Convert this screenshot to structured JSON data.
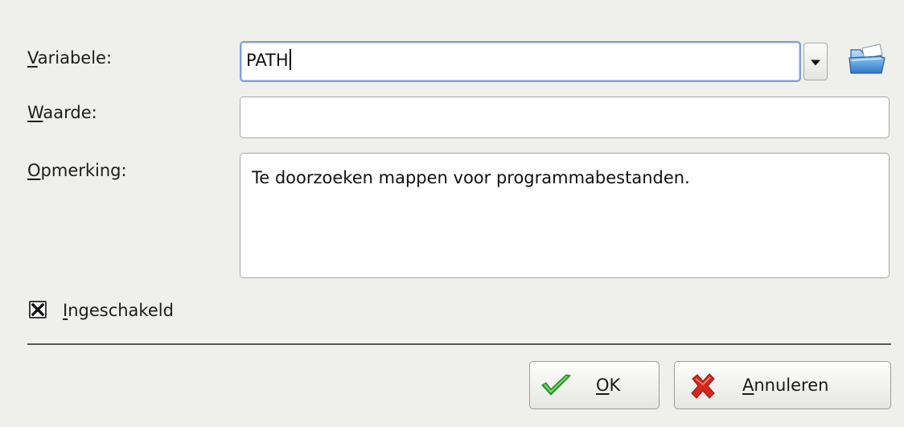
{
  "form": {
    "variable": {
      "label_mnemonic": "V",
      "label_rest": "ariabele:",
      "value": "PATH"
    },
    "value": {
      "label_mnemonic": "W",
      "label_rest": "aarde:",
      "value": ""
    },
    "comment": {
      "label_mnemonic": "O",
      "label_rest": "pmerking:",
      "value": "Te doorzoeken mappen voor programmabestanden."
    },
    "enabled": {
      "label_mnemonic": "I",
      "label_rest": "ngeschakeld",
      "checked": true
    }
  },
  "buttons": {
    "ok": {
      "label_mnemonic": "O",
      "label_rest": "K",
      "icon": "checkmark-icon"
    },
    "cancel": {
      "label_mnemonic": "A",
      "label_rest": "nnuleren",
      "icon": "cancel-x-icon"
    },
    "browse_icon": "folder-open-icon"
  },
  "colors": {
    "background": "#efefec",
    "focus_border": "#7f9fd6",
    "ok_check": "#2fb02a",
    "cancel_x": "#d8261c"
  }
}
